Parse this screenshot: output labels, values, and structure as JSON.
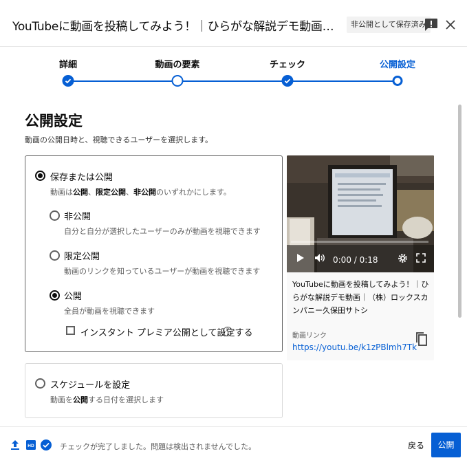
{
  "header": {
    "title": "YouTubeに動画を投稿してみよう！｜ひらがな解説デモ動画｜（株）ロックスカンパニー久保田サトシ",
    "saved_badge": "非公開として保存済み",
    "feedback_icon": "feedback-icon",
    "close_icon": "close-icon"
  },
  "stepper": {
    "steps": [
      {
        "label": "詳細",
        "state": "done"
      },
      {
        "label": "動画の要素",
        "state": "visited"
      },
      {
        "label": "チェック",
        "state": "done"
      },
      {
        "label": "公開設定",
        "state": "current"
      }
    ]
  },
  "visibility": {
    "title": "公開設定",
    "description": "動画の公開日時と、視聴できるユーザーを選択します。",
    "save_or_publish": {
      "label": "保存または公開",
      "desc_parts": [
        "動画は",
        "公開",
        "、",
        "限定公開",
        "、",
        "非公開",
        "のいずれかにします。"
      ],
      "selected": true
    },
    "options": [
      {
        "label": "非公開",
        "desc": "自分と自分が選択したユーザーのみが動画を視聴できます",
        "selected": false
      },
      {
        "label": "限定公開",
        "desc": "動画のリンクを知っているユーザーが動画を視聴できます",
        "selected": false
      },
      {
        "label": "公開",
        "desc": "全員が動画を視聴できます",
        "selected": true
      }
    ],
    "premiere": {
      "label": "インスタント プレミア公開として設定する",
      "checked": false,
      "help": "?"
    },
    "schedule": {
      "label": "スケジュールを設定",
      "desc_parts": [
        "動画を",
        "公開",
        "する日付を選択します"
      ],
      "selected": false
    }
  },
  "preview": {
    "time": "0:00 / 0:18",
    "video_title": "YouTubeに動画を投稿してみよう！｜ひらがな解説デモ動画｜（株）ロックスカンパニー久保田サトシ",
    "link_label": "動画リンク",
    "link_url": "https://youtu.be/k1zPBlmh7Tk"
  },
  "footer": {
    "status": "チェックが完了しました。問題は検出されませんでした。",
    "back_label": "戻る",
    "publish_label": "公開",
    "accent": "#065fd4"
  }
}
